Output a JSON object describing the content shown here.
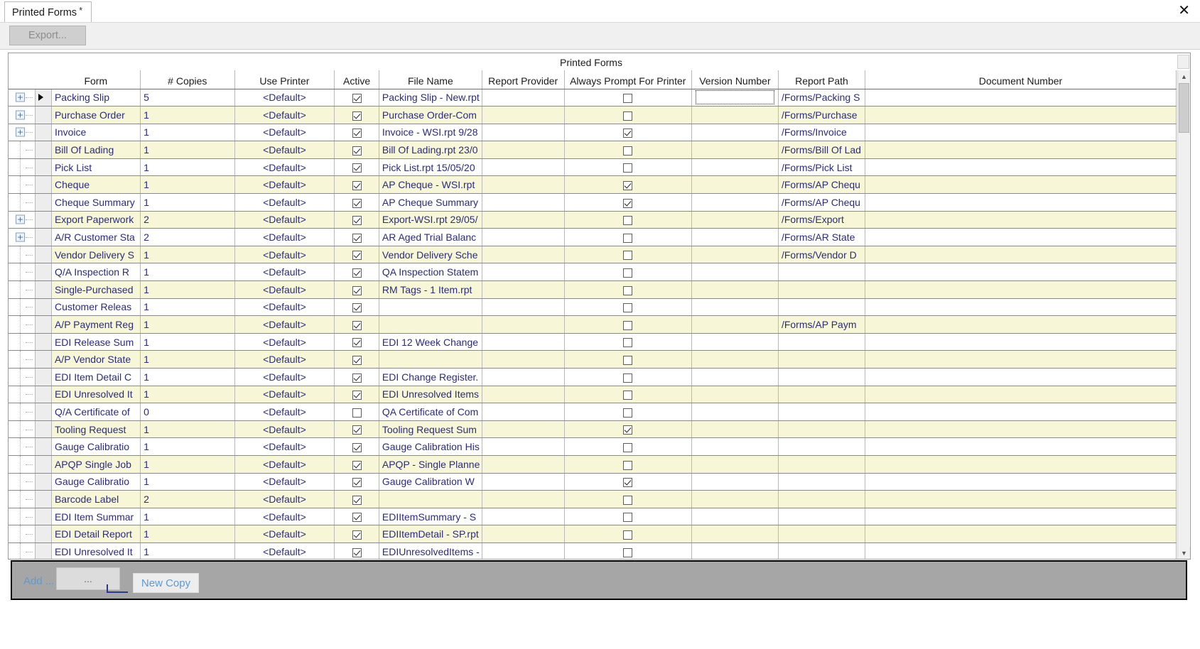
{
  "window": {
    "close_label": "✕"
  },
  "tab": {
    "label": "Printed Forms",
    "dirty_marker": "*"
  },
  "toolbar": {
    "export_label": "Export..."
  },
  "grid": {
    "group_title": "Printed Forms",
    "columns": [
      "Form",
      "# Copies",
      "Use Printer",
      "Active",
      "File Name",
      "Report Provider",
      "Always Prompt For Printer",
      "Version Number",
      "Report Path",
      "Document Number"
    ],
    "rows": [
      {
        "expandable": true,
        "selected": true,
        "form": "Packing Slip",
        "copies": "5",
        "printer": "<Default>",
        "active": true,
        "file": "Packing Slip - New.rpt",
        "provider": "",
        "prompt": false,
        "version": "",
        "editing_version": true,
        "path": "/Forms/Packing S",
        "doc": ""
      },
      {
        "expandable": true,
        "selected": false,
        "form": "Purchase Order",
        "copies": "1",
        "printer": "<Default>",
        "active": true,
        "file": "Purchase Order-Com",
        "provider": "",
        "prompt": false,
        "version": "",
        "editing_version": false,
        "path": "/Forms/Purchase",
        "doc": ""
      },
      {
        "expandable": true,
        "selected": false,
        "form": "Invoice",
        "copies": "1",
        "printer": "<Default>",
        "active": true,
        "file": "Invoice - WSI.rpt 9/28",
        "provider": "",
        "prompt": true,
        "version": "",
        "editing_version": false,
        "path": "/Forms/Invoice",
        "doc": ""
      },
      {
        "expandable": false,
        "selected": false,
        "form": "Bill Of Lading",
        "copies": "1",
        "printer": "<Default>",
        "active": true,
        "file": "Bill Of Lading.rpt 23/0",
        "provider": "",
        "prompt": false,
        "version": "",
        "editing_version": false,
        "path": "/Forms/Bill Of Lad",
        "doc": ""
      },
      {
        "expandable": false,
        "selected": false,
        "form": "Pick List",
        "copies": "1",
        "printer": "<Default>",
        "active": true,
        "file": "Pick List.rpt 15/05/20",
        "provider": "",
        "prompt": false,
        "version": "",
        "editing_version": false,
        "path": "/Forms/Pick List",
        "doc": ""
      },
      {
        "expandable": false,
        "selected": false,
        "form": "Cheque",
        "copies": "1",
        "printer": "<Default>",
        "active": true,
        "file": "AP Cheque - WSI.rpt",
        "provider": "",
        "prompt": true,
        "version": "",
        "editing_version": false,
        "path": "/Forms/AP Chequ",
        "doc": ""
      },
      {
        "expandable": false,
        "selected": false,
        "form": "Cheque Summary",
        "copies": "1",
        "printer": "<Default>",
        "active": true,
        "file": "AP Cheque Summary",
        "provider": "",
        "prompt": true,
        "version": "",
        "editing_version": false,
        "path": "/Forms/AP Chequ",
        "doc": ""
      },
      {
        "expandable": true,
        "selected": false,
        "form": "Export Paperwork",
        "copies": "2",
        "printer": "<Default>",
        "active": true,
        "file": "Export-WSI.rpt 29/05/",
        "provider": "",
        "prompt": false,
        "version": "",
        "editing_version": false,
        "path": "/Forms/Export",
        "doc": ""
      },
      {
        "expandable": true,
        "selected": false,
        "form": "A/R Customer Sta",
        "copies": "2",
        "printer": "<Default>",
        "active": true,
        "file": "AR Aged Trial Balanc",
        "provider": "",
        "prompt": false,
        "version": "",
        "editing_version": false,
        "path": "/Forms/AR State",
        "doc": ""
      },
      {
        "expandable": false,
        "selected": false,
        "form": "Vendor Delivery S",
        "copies": "1",
        "printer": "<Default>",
        "active": true,
        "file": "Vendor Delivery Sche",
        "provider": "",
        "prompt": false,
        "version": "",
        "editing_version": false,
        "path": "/Forms/Vendor D",
        "doc": ""
      },
      {
        "expandable": false,
        "selected": false,
        "form": "Q/A Inspection R",
        "copies": "1",
        "printer": "<Default>",
        "active": true,
        "file": "QA Inspection Statem",
        "provider": "",
        "prompt": false,
        "version": "",
        "editing_version": false,
        "path": "",
        "doc": ""
      },
      {
        "expandable": false,
        "selected": false,
        "form": "Single-Purchased",
        "copies": "1",
        "printer": "<Default>",
        "active": true,
        "file": "RM Tags - 1 Item.rpt",
        "provider": "",
        "prompt": false,
        "version": "",
        "editing_version": false,
        "path": "",
        "doc": ""
      },
      {
        "expandable": false,
        "selected": false,
        "form": "Customer Releas",
        "copies": "1",
        "printer": "<Default>",
        "active": true,
        "file": "",
        "provider": "",
        "prompt": false,
        "version": "",
        "editing_version": false,
        "path": "",
        "doc": ""
      },
      {
        "expandable": false,
        "selected": false,
        "form": "A/P Payment Reg",
        "copies": "1",
        "printer": "<Default>",
        "active": true,
        "file": "",
        "provider": "",
        "prompt": false,
        "version": "",
        "editing_version": false,
        "path": "/Forms/AP Paym",
        "doc": ""
      },
      {
        "expandable": false,
        "selected": false,
        "form": "EDI Release Sum",
        "copies": "1",
        "printer": "<Default>",
        "active": true,
        "file": "EDI 12 Week Change",
        "provider": "",
        "prompt": false,
        "version": "",
        "editing_version": false,
        "path": "",
        "doc": ""
      },
      {
        "expandable": false,
        "selected": false,
        "form": "A/P Vendor State",
        "copies": "1",
        "printer": "<Default>",
        "active": true,
        "file": "",
        "provider": "",
        "prompt": false,
        "version": "",
        "editing_version": false,
        "path": "",
        "doc": ""
      },
      {
        "expandable": false,
        "selected": false,
        "form": "EDI Item Detail C",
        "copies": "1",
        "printer": "<Default>",
        "active": true,
        "file": "EDI Change Register.",
        "provider": "",
        "prompt": false,
        "version": "",
        "editing_version": false,
        "path": "",
        "doc": ""
      },
      {
        "expandable": false,
        "selected": false,
        "form": "EDI Unresolved It",
        "copies": "1",
        "printer": "<Default>",
        "active": true,
        "file": "EDI Unresolved Items",
        "provider": "",
        "prompt": false,
        "version": "",
        "editing_version": false,
        "path": "",
        "doc": ""
      },
      {
        "expandable": false,
        "selected": false,
        "form": "Q/A Certificate of",
        "copies": "0",
        "printer": "<Default>",
        "active": false,
        "file": "QA Certificate of Com",
        "provider": "",
        "prompt": false,
        "version": "",
        "editing_version": false,
        "path": "",
        "doc": ""
      },
      {
        "expandable": false,
        "selected": false,
        "form": "Tooling Request",
        "copies": "1",
        "printer": "<Default>",
        "active": true,
        "file": "Tooling Request Sum",
        "provider": "",
        "prompt": true,
        "version": "",
        "editing_version": false,
        "path": "",
        "doc": ""
      },
      {
        "expandable": false,
        "selected": false,
        "form": "Gauge Calibratio",
        "copies": "1",
        "printer": "<Default>",
        "active": true,
        "file": "Gauge Calibration His",
        "provider": "",
        "prompt": false,
        "version": "",
        "editing_version": false,
        "path": "",
        "doc": ""
      },
      {
        "expandable": false,
        "selected": false,
        "form": "APQP Single Job",
        "copies": "1",
        "printer": "<Default>",
        "active": true,
        "file": "APQP - Single Planne",
        "provider": "",
        "prompt": false,
        "version": "",
        "editing_version": false,
        "path": "",
        "doc": ""
      },
      {
        "expandable": false,
        "selected": false,
        "form": "Gauge Calibratio",
        "copies": "1",
        "printer": "<Default>",
        "active": true,
        "file": "Gauge Calibration W",
        "provider": "",
        "prompt": true,
        "version": "",
        "editing_version": false,
        "path": "",
        "doc": ""
      },
      {
        "expandable": false,
        "selected": false,
        "form": "Barcode Label",
        "copies": "2",
        "printer": "<Default>",
        "active": true,
        "file": "",
        "provider": "",
        "prompt": false,
        "version": "",
        "editing_version": false,
        "path": "",
        "doc": ""
      },
      {
        "expandable": false,
        "selected": false,
        "form": "EDI Item Summar",
        "copies": "1",
        "printer": "<Default>",
        "active": true,
        "file": "EDIItemSummary - S",
        "provider": "",
        "prompt": false,
        "version": "",
        "editing_version": false,
        "path": "",
        "doc": ""
      },
      {
        "expandable": false,
        "selected": false,
        "form": "EDI Detail Report",
        "copies": "1",
        "printer": "<Default>",
        "active": true,
        "file": "EDIItemDetail - SP.rpt",
        "provider": "",
        "prompt": false,
        "version": "",
        "editing_version": false,
        "path": "",
        "doc": ""
      },
      {
        "expandable": false,
        "selected": false,
        "form": "EDI Unresolved It",
        "copies": "1",
        "printer": "<Default>",
        "active": true,
        "file": "EDIUnresolvedItems -",
        "provider": "",
        "prompt": false,
        "version": "",
        "editing_version": false,
        "path": "",
        "doc": ""
      }
    ]
  },
  "footer": {
    "add_label": "Add ...",
    "ellipsis_label": "...",
    "new_copy_label": "New Copy"
  },
  "scroll": {
    "up_arrow": "▲",
    "down_arrow": "▼"
  }
}
